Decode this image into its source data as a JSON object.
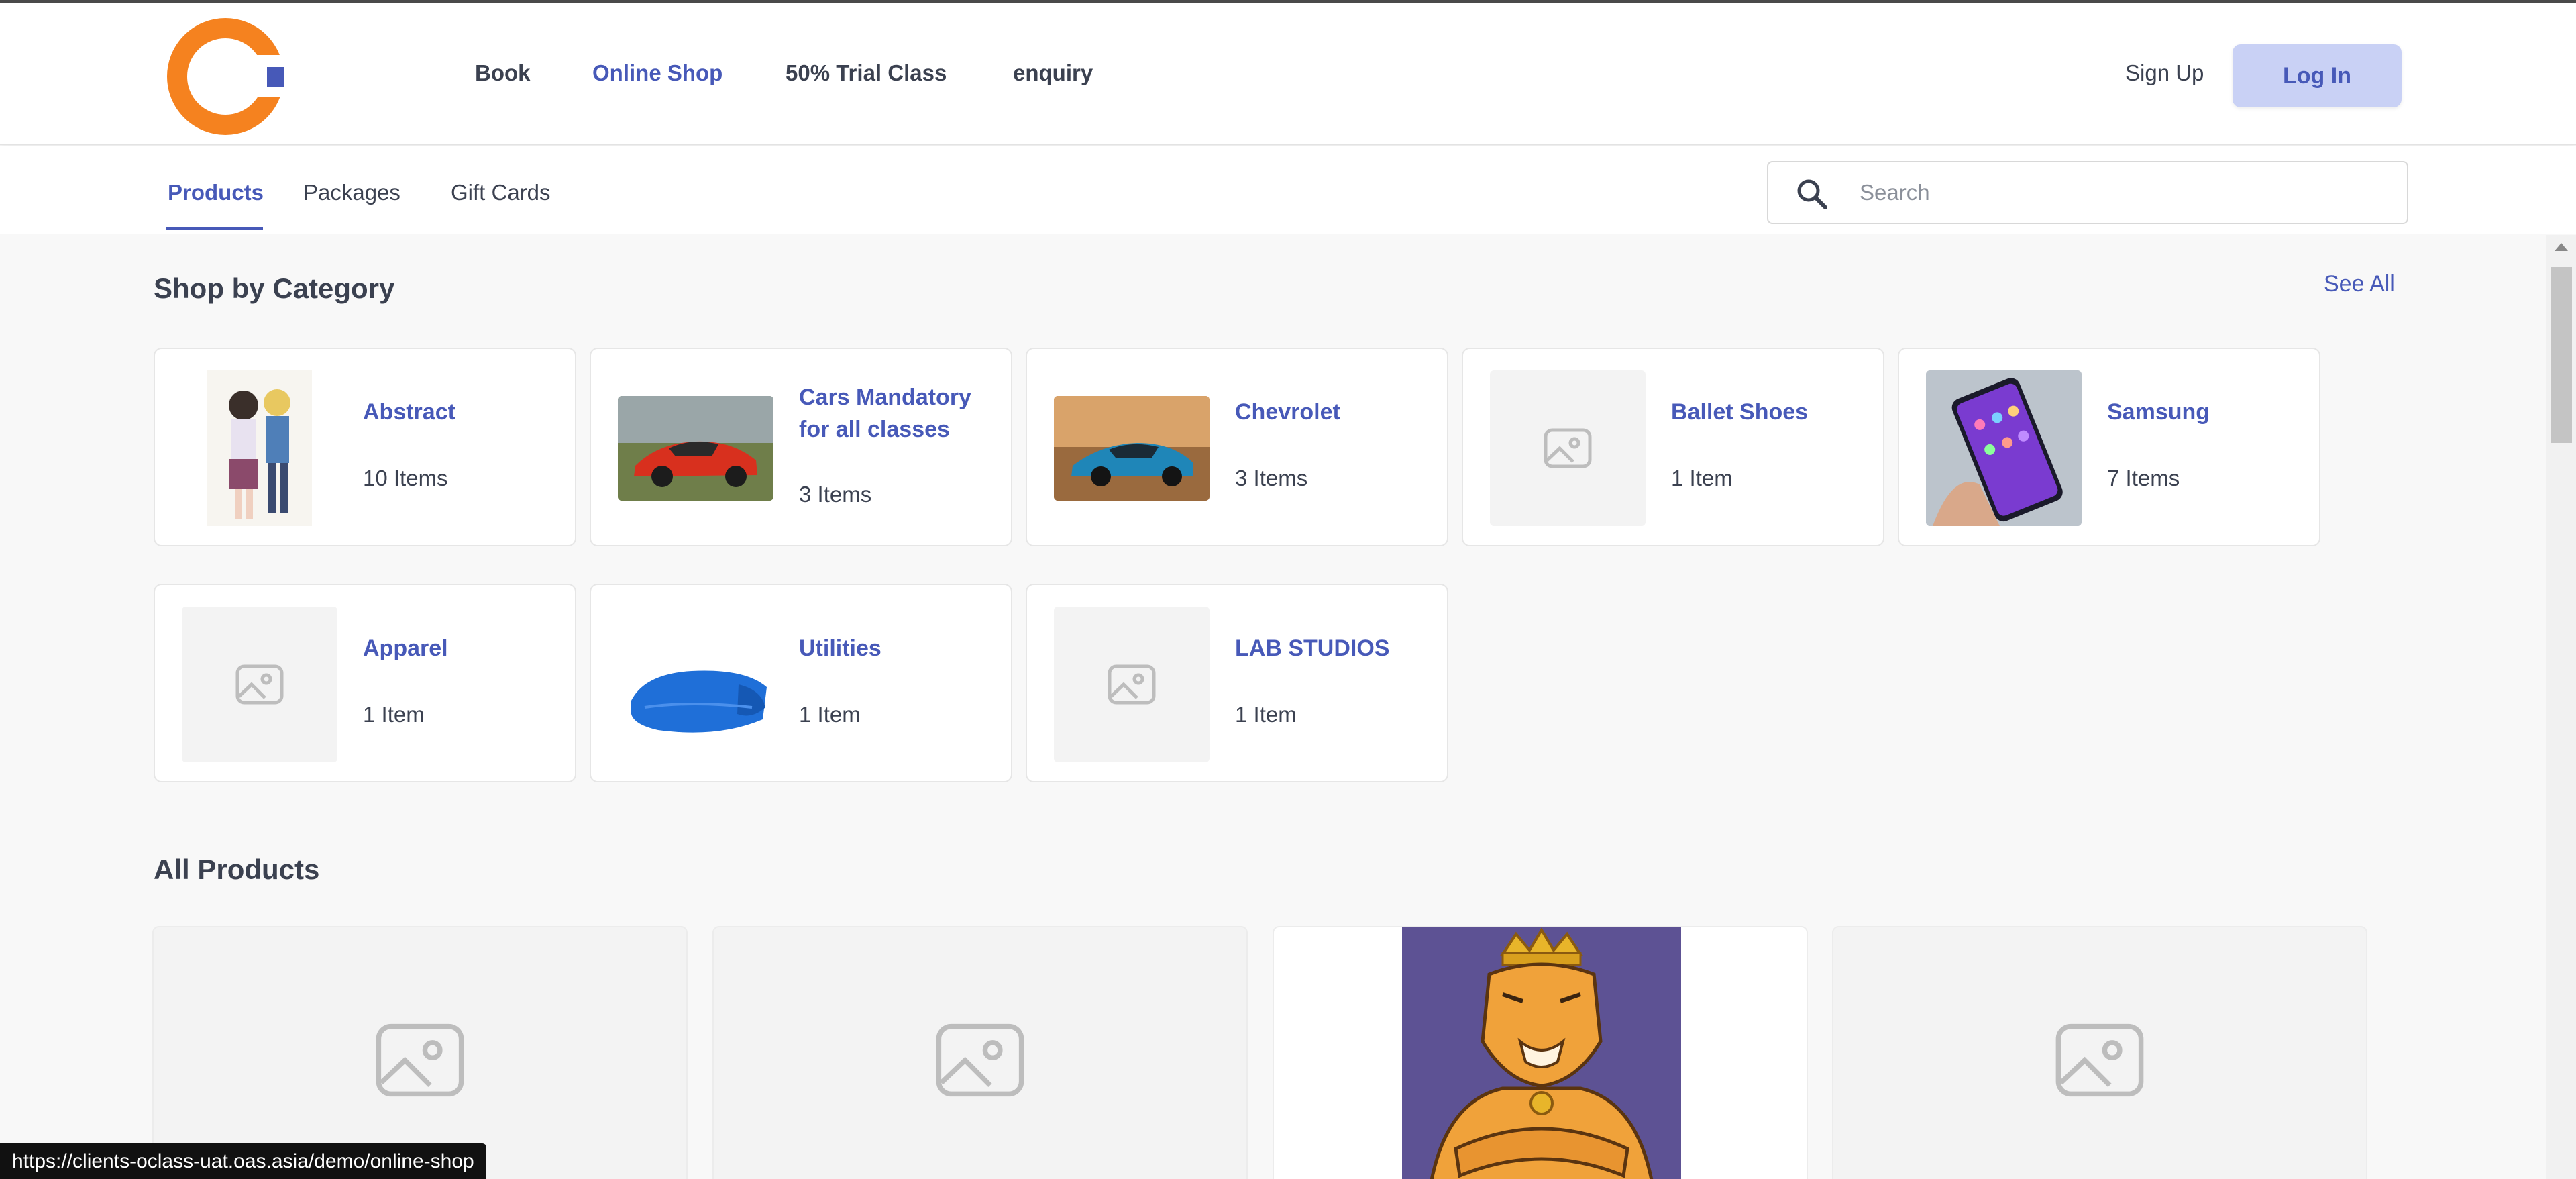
{
  "colors": {
    "accent": "#4759b8",
    "logo_orange": "#f5821f",
    "login_bg": "#c9d1f5"
  },
  "header": {
    "logo_icon": "brand-logo-icon",
    "nav": [
      {
        "label": "Book"
      },
      {
        "label": "Online Shop",
        "active": true
      },
      {
        "label": "50% Trial Class"
      },
      {
        "label": "enquiry"
      }
    ],
    "sign_up": "Sign Up",
    "log_in": "Log In"
  },
  "subnav": {
    "tabs": [
      {
        "label": "Products",
        "active": true
      },
      {
        "label": "Packages"
      },
      {
        "label": "Gift Cards"
      }
    ],
    "search": {
      "placeholder": "Search",
      "value": ""
    }
  },
  "categories": {
    "title": "Shop by Category",
    "see_all": "See All",
    "items": [
      {
        "name": "Abstract",
        "count": "10 Items",
        "image": "manga-cover"
      },
      {
        "name": "Cars Mandatory for all classes",
        "count": "3 Items",
        "image": "red-sports-car"
      },
      {
        "name": "Chevrolet",
        "count": "3 Items",
        "image": "blue-sports-car"
      },
      {
        "name": "Ballet Shoes",
        "count": "1 Item",
        "image": "placeholder-image-icon"
      },
      {
        "name": "Samsung",
        "count": "7 Items",
        "image": "smartphone-in-hand"
      },
      {
        "name": "Apparel",
        "count": "1 Item",
        "image": "placeholder-image-icon"
      },
      {
        "name": "Utilities",
        "count": "1 Item",
        "image": "blue-towel"
      },
      {
        "name": "LAB STUDIOS",
        "count": "1 Item",
        "image": "placeholder-image-icon"
      }
    ]
  },
  "products": {
    "title": "All Products",
    "items": [
      {
        "image": "placeholder-image-icon"
      },
      {
        "image": "placeholder-image-icon"
      },
      {
        "image": "crowned-tiger-illustration"
      },
      {
        "image": "placeholder-image-icon"
      }
    ]
  },
  "status_bar": {
    "url": "https://clients-oclass-uat.oas.asia/demo/online-shop"
  }
}
